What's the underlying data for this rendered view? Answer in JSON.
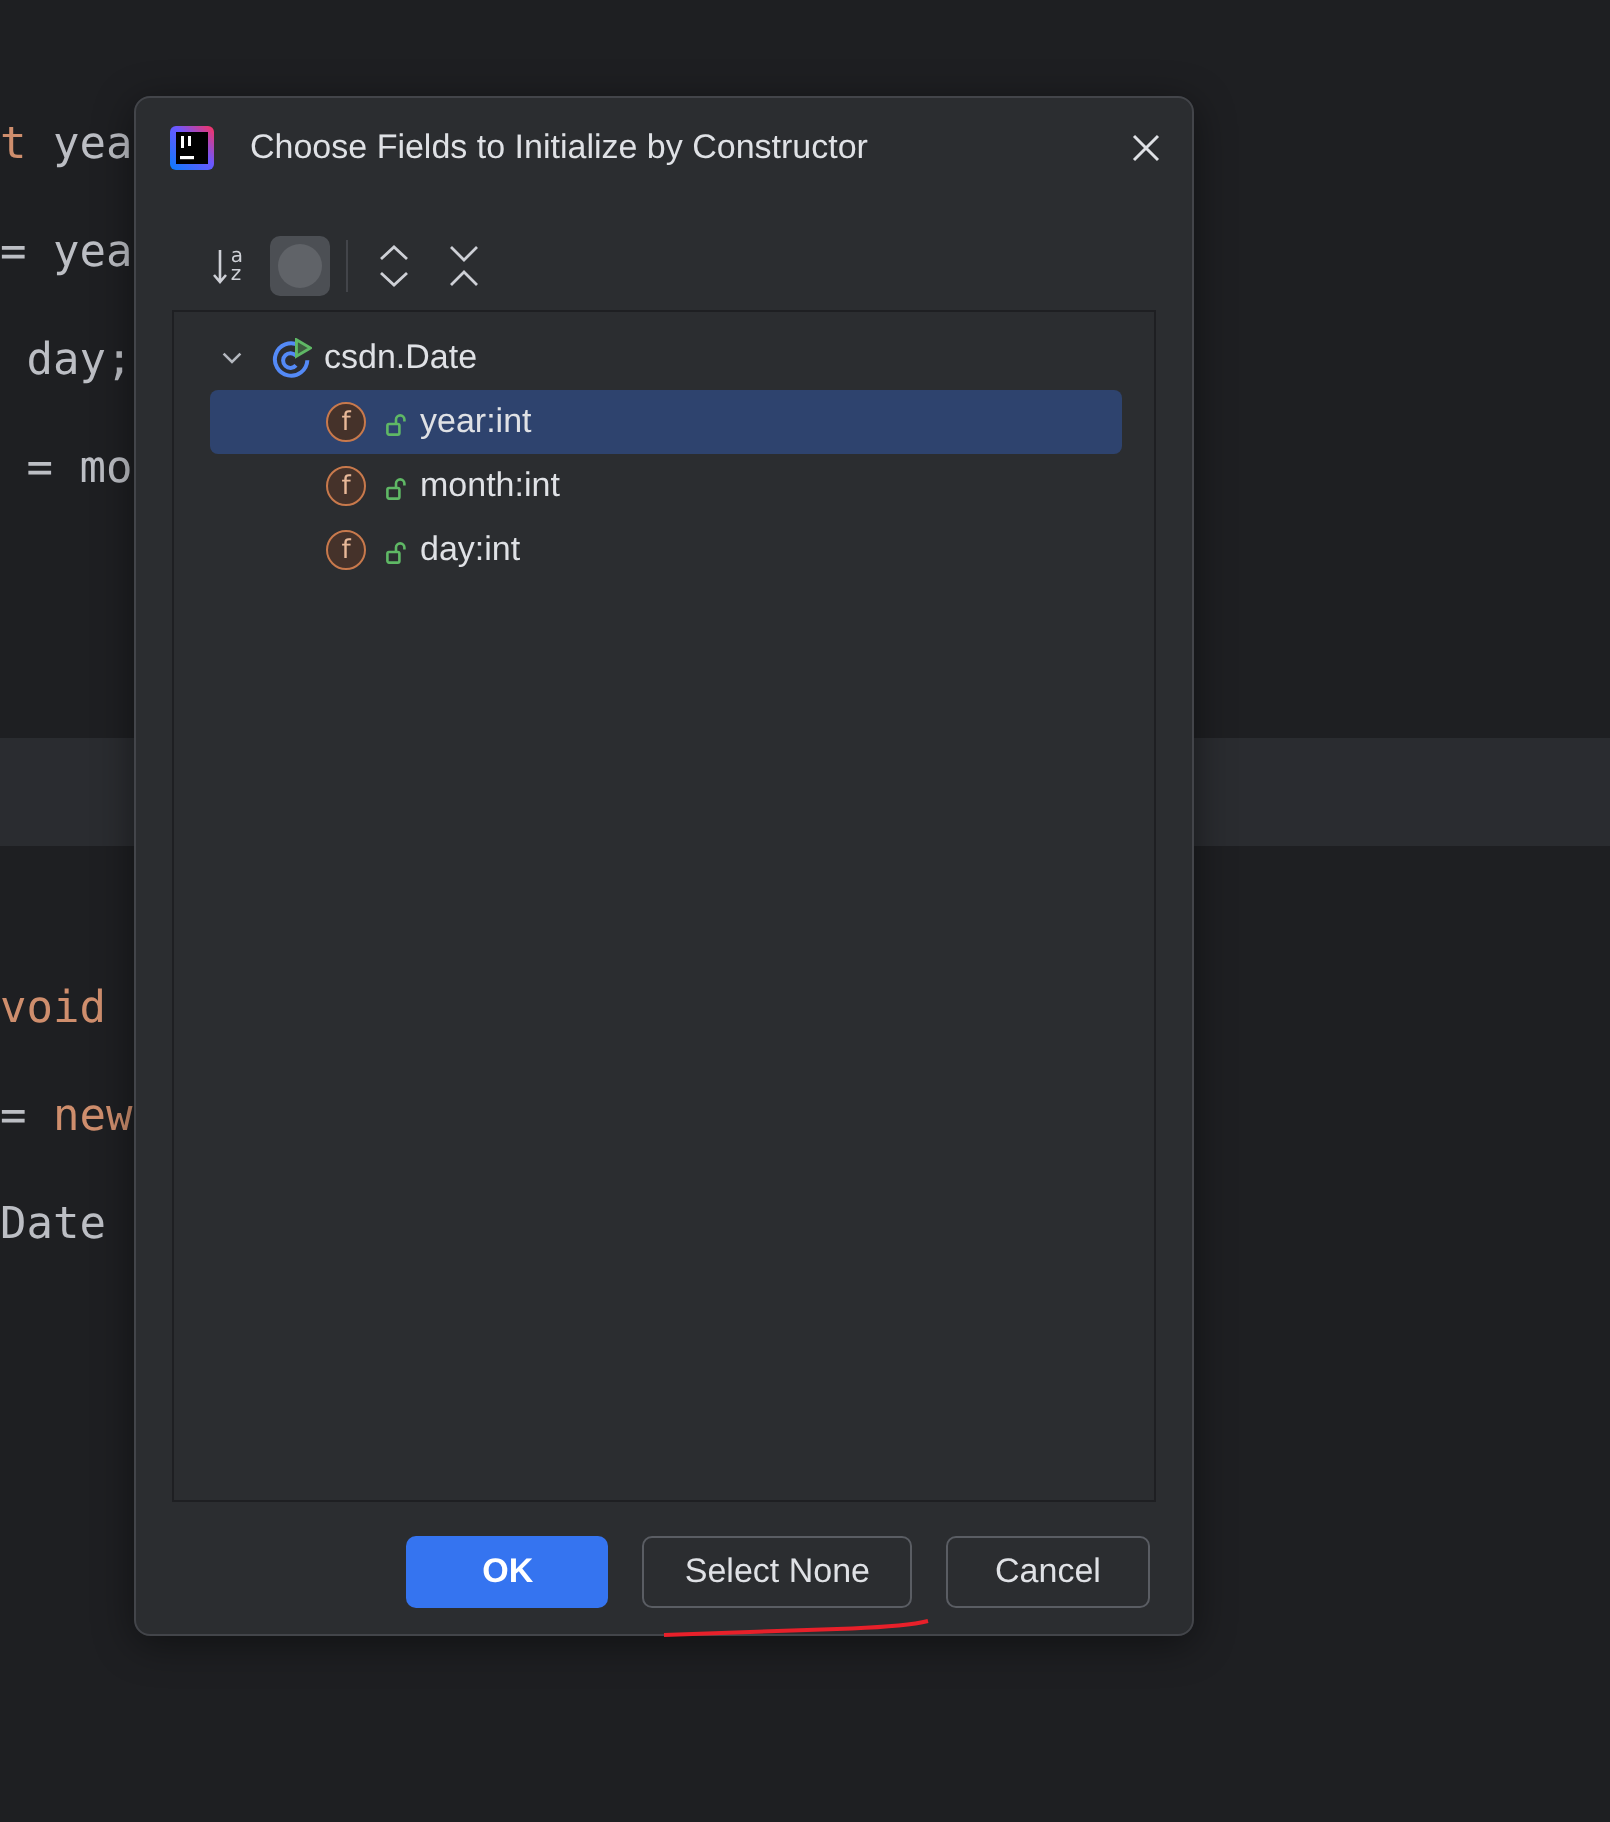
{
  "editor": {
    "lines": [
      {
        "kind": "code",
        "indented": false,
        "segments": [
          {
            "text": "t",
            "kind": "keyword"
          },
          {
            "text": "yea",
            "kind": "plain"
          }
        ]
      },
      {
        "kind": "code",
        "indented": false,
        "segments": [
          {
            "text": "=",
            "kind": "plain"
          },
          {
            "text": "yea",
            "kind": "plain"
          }
        ]
      },
      {
        "kind": "code",
        "indented": true,
        "segments": [
          {
            "text": "day;",
            "kind": "plain"
          }
        ]
      },
      {
        "kind": "code",
        "indented": true,
        "segments": [
          {
            "text": "=",
            "kind": "plain"
          },
          {
            "text": "mo",
            "kind": "plain"
          }
        ]
      },
      {
        "kind": "blank"
      },
      {
        "kind": "blank"
      },
      {
        "kind": "caret_line"
      },
      {
        "kind": "blank"
      },
      {
        "kind": "code",
        "indented": false,
        "segments": [
          {
            "text": "void",
            "kind": "keyword"
          }
        ]
      },
      {
        "kind": "code",
        "indented": false,
        "segments": [
          {
            "text": "=",
            "kind": "plain"
          },
          {
            "text": "new",
            "kind": "keyword"
          }
        ]
      },
      {
        "kind": "code",
        "indented": false,
        "segments": [
          {
            "text": "Date",
            "kind": "plain"
          }
        ]
      }
    ]
  },
  "dialog": {
    "title": "Choose Fields to Initialize by Constructor",
    "toolbar": [
      {
        "kind": "sort",
        "letters": [
          "a",
          "z"
        ],
        "selected": false
      },
      {
        "kind": "toggle",
        "selected": true
      },
      {
        "kind": "separator"
      },
      {
        "kind": "expand_all",
        "selected": false
      },
      {
        "kind": "collapse_all",
        "selected": false
      }
    ],
    "tree": [
      {
        "label": "csdn.Date",
        "kind": "class",
        "expanded": true,
        "selected": false,
        "children": [
          {
            "label": "year:int",
            "kind": "field",
            "icon_letter": "f",
            "selected": true
          },
          {
            "label": "month:int",
            "kind": "field",
            "icon_letter": "f",
            "selected": false
          },
          {
            "label": "day:int",
            "kind": "field",
            "icon_letter": "f",
            "selected": false
          }
        ]
      }
    ],
    "buttons": [
      {
        "label": "OK",
        "kind": "primary",
        "underlined": false
      },
      {
        "label": "Select None",
        "kind": "secondary",
        "underlined": true
      },
      {
        "label": "Cancel",
        "kind": "secondary",
        "underlined": false
      }
    ]
  }
}
